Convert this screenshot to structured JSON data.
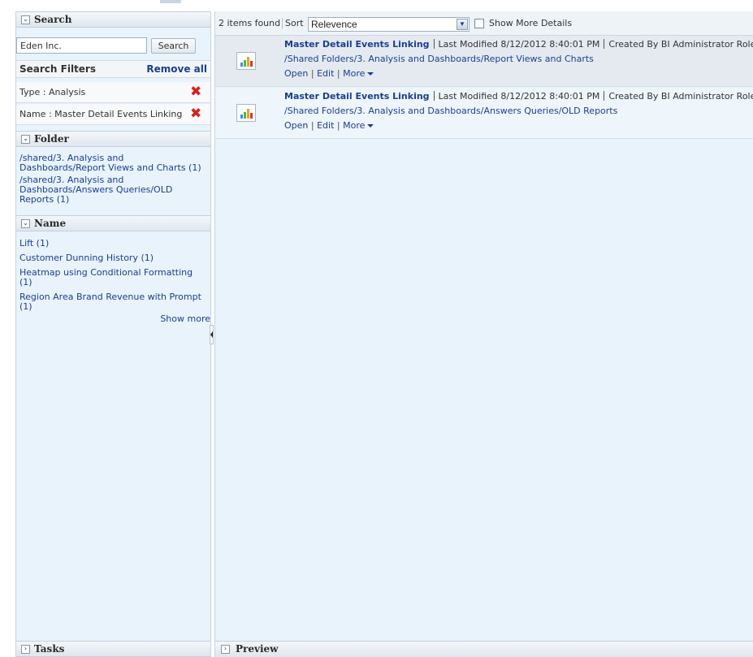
{
  "left": {
    "search_header": "Search",
    "search_value": "Eden Inc.",
    "search_button": "Search",
    "filters_title": "Search Filters",
    "remove_all": "Remove all",
    "filters": [
      {
        "label": "Type : Analysis"
      },
      {
        "label": "Name : Master Detail Events Linking"
      }
    ],
    "folder_header": "Folder",
    "folders": [
      "/shared/3. Analysis and Dashboards/Report Views and Charts (1)",
      "/shared/3. Analysis and Dashboards/Answers Queries/OLD Reports (1)"
    ],
    "name_header": "Name",
    "names": [
      "Lift (1)",
      "Customer Dunning History (1)",
      "Heatmap using Conditional Formatting (1)",
      "Region Area Brand Revenue with Prompt (1)"
    ],
    "show_more": "Show more",
    "tasks_header": "Tasks"
  },
  "toolbar": {
    "count": "2 items found",
    "sort_label": "Sort",
    "sort_value": "Relevence",
    "show_details": "Show More Details"
  },
  "results": [
    {
      "title": "Master Detail Events Linking",
      "modified": "Last Modified 8/12/2012 8:40:01 PM",
      "created": "Created By BI Administrator Role",
      "path": "/Shared Folders/3. Analysis and Dashboards/Report Views and Charts",
      "open": "Open",
      "edit": "Edit",
      "more": "More"
    },
    {
      "title": "Master Detail Events Linking",
      "modified": "Last Modified 8/12/2012 8:40:01 PM",
      "created": "Created By BI Administrator Role",
      "path": "/Shared Folders/3. Analysis and Dashboards/Answers Queries/OLD Reports",
      "open": "Open",
      "edit": "Edit",
      "more": "More"
    }
  ],
  "preview_header": "Preview",
  "colors": {
    "link": "#1b3f8f",
    "panel_bg": "#e8f3fb",
    "remove_x": "#d3221b"
  }
}
